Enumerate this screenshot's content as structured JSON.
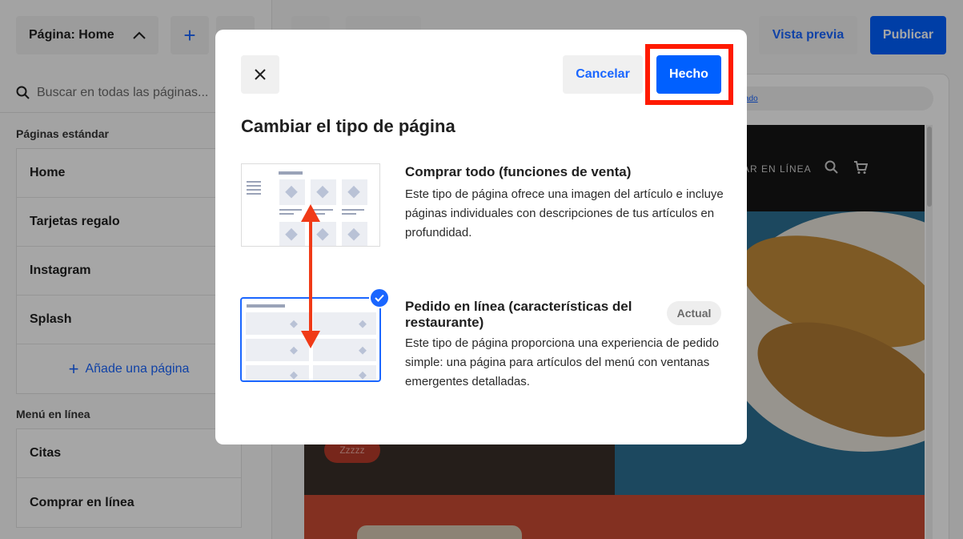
{
  "sidebar": {
    "page_selector_label": "Página: Home",
    "search_placeholder": "Buscar en todas las páginas...",
    "standard_section_title": "Páginas estándar",
    "standard_pages": [
      "Home",
      "Tarjetas regalo",
      "Instagram",
      "Splash"
    ],
    "add_page_label": "Añade una página",
    "online_menu_title": "Menú en línea",
    "online_pages": [
      "Citas",
      "Comprar en línea"
    ]
  },
  "topbar": {
    "preview_label": "Vista previa",
    "publish_label": "Publicar"
  },
  "site_preview": {
    "url_text": "zado",
    "nav_text": "AR EN LÍNEA",
    "pill_text": "Zzzzz"
  },
  "modal": {
    "close_icon": "close-icon",
    "cancel_label": "Cancelar",
    "done_label": "Hecho",
    "title": "Cambiar el tipo de página",
    "option_shop": {
      "title": "Comprar todo (funciones de venta)",
      "description": "Este tipo de página ofrece una imagen del artículo e incluye páginas individuales con descripciones de tus artículos en profundidad."
    },
    "option_order": {
      "title_line1": "Pedido en línea (características del",
      "title_line2": "restaurante)",
      "badge": "Actual",
      "description": "Este tipo de página proporciona una experiencia de pedido simple: una página para artículos del menú con ventanas emergentes detalladas.",
      "selected": true
    }
  },
  "colors": {
    "accent": "#0060ff",
    "highlight": "#ff1a00",
    "arrow": "#f03a17"
  }
}
